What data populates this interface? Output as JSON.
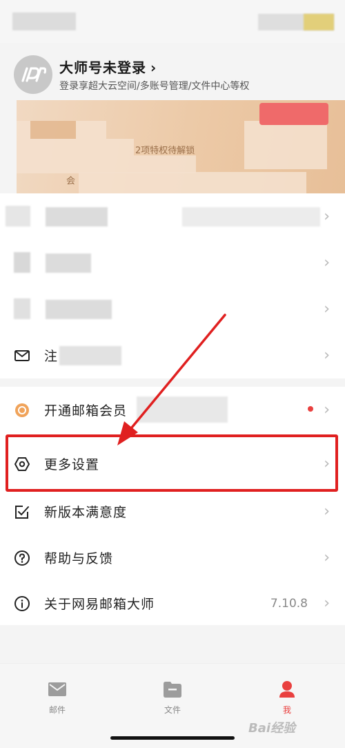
{
  "profile": {
    "name": "大师号未登录",
    "subtitle": "登录享超大云空间/多账号管理/文件中心等权"
  },
  "vip": {
    "benefit_text": "2项特权待解锁",
    "tag_text": "会"
  },
  "menu": {
    "item_mail": "注",
    "item_vip": "开通邮箱会员",
    "item_settings": "更多设置",
    "item_feedback_survey": "新版本满意度",
    "item_help": "帮助与反馈",
    "item_about": "关于网易邮箱大师",
    "version": "7.10.8"
  },
  "tabs": {
    "mail": "邮件",
    "files": "文件",
    "me": "我"
  },
  "watermark": "Bai经验",
  "colors": {
    "accent": "#e9403f",
    "highlight": "#e02020",
    "vip_bg": "#ecc9a6"
  }
}
